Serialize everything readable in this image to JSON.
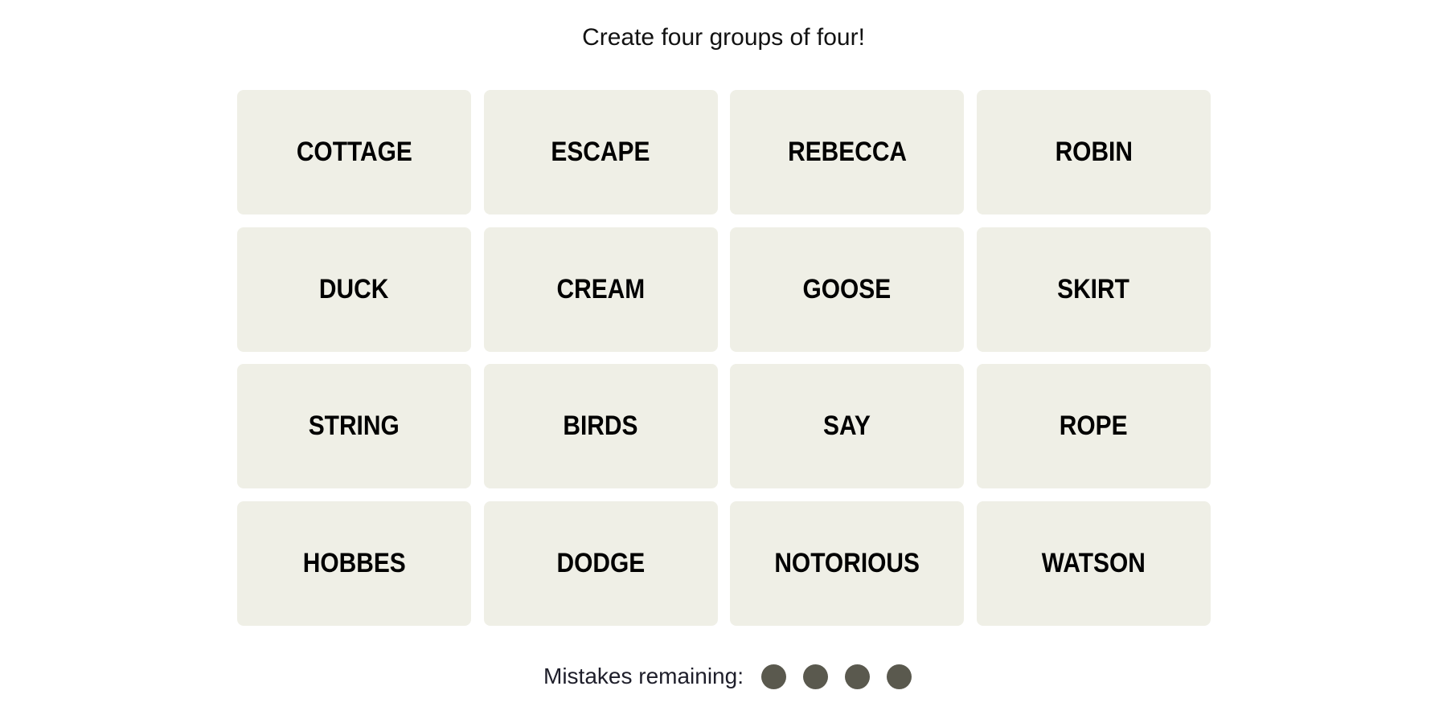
{
  "header": {
    "title": "Create four groups of four!"
  },
  "board": {
    "tiles": [
      {
        "label": "COTTAGE"
      },
      {
        "label": "ESCAPE"
      },
      {
        "label": "REBECCA"
      },
      {
        "label": "ROBIN"
      },
      {
        "label": "DUCK"
      },
      {
        "label": "CREAM"
      },
      {
        "label": "GOOSE"
      },
      {
        "label": "SKIRT"
      },
      {
        "label": "STRING"
      },
      {
        "label": "BIRDS"
      },
      {
        "label": "SAY"
      },
      {
        "label": "ROPE"
      },
      {
        "label": "HOBBES"
      },
      {
        "label": "DODGE"
      },
      {
        "label": "NOTORIOUS"
      },
      {
        "label": "WATSON"
      }
    ],
    "tile_color": "#efefe6",
    "text_color": "#000000"
  },
  "status": {
    "mistakes_label": "Mistakes remaining:",
    "mistakes_remaining": 4,
    "mistakes_total": 4,
    "dot_color": "#5a594e",
    "dot_icon": "filled-circle-icon"
  }
}
